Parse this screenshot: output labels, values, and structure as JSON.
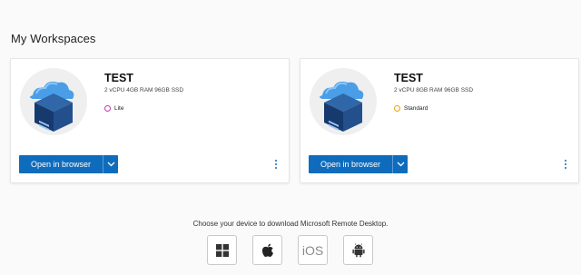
{
  "page": {
    "title": "My Workspaces"
  },
  "workspaces": [
    {
      "name": "TEST",
      "specs": "2 vCPU 4GB RAM 96GB SSD",
      "plan": "Lite",
      "plan_color": "#c239b3",
      "open_label": "Open in browser",
      "thumbnail_icon": "cloud-pc-icon"
    },
    {
      "name": "TEST",
      "specs": "2 vCPU 8GB RAM 96GB SSD",
      "plan": "Standard",
      "plan_color": "#f0a30a",
      "open_label": "Open in browser",
      "thumbnail_icon": "cloud-pc-icon"
    }
  ],
  "download": {
    "text": "Choose your device to download Microsoft Remote Desktop.",
    "ios_label": "iOS",
    "devices": [
      "windows-icon",
      "apple-icon",
      "ios-icon",
      "android-icon"
    ]
  },
  "colors": {
    "accent": "#0f6cbd",
    "background": "#fafafa"
  }
}
